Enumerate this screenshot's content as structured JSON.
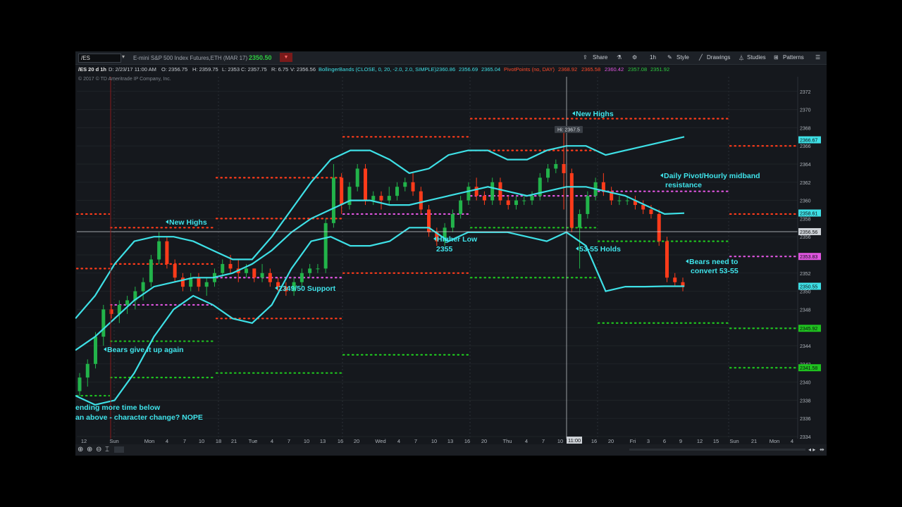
{
  "toolbar": {
    "symbol": "/ES",
    "description": "E-mini S&P 500 Index Futures,ETH (MAR 17)",
    "last_price": "2350.50",
    "share_label": "Share",
    "timeframe": "1h",
    "style_label": "Style",
    "drawings_label": "Drawings",
    "studies_label": "Studies",
    "patterns_label": "Patterns"
  },
  "header": {
    "period": "/ES 20 d 1h",
    "date": "D: 2/23/17 11:00 AM",
    "open": "O: 2356.75",
    "high": "H: 2359.75",
    "low": "L: 2353",
    "close": "C: 2357.75",
    "range": "R: 6.75",
    "value": "V: 2356.56",
    "bb_label": "BollingerBands (CLOSE, 0, 20, -2.0, 2.0, SIMPLE)",
    "bb_values": [
      "2360.86",
      "2356.69",
      "2365.04"
    ],
    "pp_label": "PivotPoints (no, DAY)",
    "pp_values": [
      "2368.92",
      "2365.58",
      "2360.42",
      "2357.08",
      "2351.92"
    ]
  },
  "copyright": "© 2017 © TD Ameritrade IP Company, Inc.",
  "colors": {
    "background": "#15181d",
    "band": "#3ee0e6",
    "up": "#22b34a",
    "down": "#ff3b1a",
    "resistance": "#ff3b1a",
    "support": "#1fc21f",
    "pivot": "#e055e0",
    "annotation": "#3fe3ea"
  },
  "chart_data": {
    "type": "candlestick",
    "title": "/ES 20 d 1h",
    "ylim": [
      2333,
      2373
    ],
    "y_ticks": [
      2334,
      2336,
      2338,
      2340,
      2342,
      2344,
      2346,
      2348,
      2350,
      2352,
      2354,
      2356,
      2358,
      2360,
      2362,
      2364,
      2366,
      2368,
      2370,
      2372
    ],
    "x_ticks": [
      "12",
      "Sun",
      "Mon",
      "4",
      "7",
      "10",
      "18",
      "21",
      "Tue",
      "4",
      "7",
      "10",
      "13",
      "16",
      "20",
      "Wed",
      "4",
      "7",
      "10",
      "13",
      "16",
      "20",
      "Thu",
      "4",
      "7",
      "10",
      "11:00",
      "16",
      "20",
      "Fri",
      "3",
      "6",
      "9",
      "12",
      "15",
      "Sun",
      "21",
      "Mon",
      "4"
    ],
    "price_labels": [
      {
        "value": 2366.67,
        "text": "2366.67",
        "color": "#3ee0e6"
      },
      {
        "value": 2358.61,
        "text": "2358.61",
        "color": "#3ee0e6"
      },
      {
        "value": 2356.56,
        "text": "2356.56",
        "color": "#cfd3d8"
      },
      {
        "value": 2353.83,
        "text": "2353.83",
        "color": "#e055e0"
      },
      {
        "value": 2350.55,
        "text": "2350.55",
        "color": "#3ee0e6"
      },
      {
        "value": 2345.92,
        "text": "2345.92",
        "color": "#1fc21f"
      },
      {
        "value": 2341.58,
        "text": "2341.58",
        "color": "#1fc21f"
      }
    ],
    "crosshair": {
      "x_label": "11:00",
      "price": 2356.56
    },
    "hi_marker": {
      "text": "Hi: 2367.5",
      "value": 2367.5
    },
    "candles": [
      [
        2339.0,
        2341.0,
        2338.5,
        2340.5
      ],
      [
        2340.5,
        2342.5,
        2339.5,
        2342.0
      ],
      [
        2342.0,
        2345.5,
        2341.5,
        2345.0
      ],
      [
        2345.0,
        2348.5,
        2344.0,
        2348.0
      ],
      [
        2348.0,
        2348.5,
        2347.0,
        2347.5
      ],
      [
        2347.5,
        2349.0,
        2346.5,
        2348.5
      ],
      [
        2348.5,
        2349.5,
        2347.5,
        2349.0
      ],
      [
        2349.0,
        2350.5,
        2348.0,
        2350.0
      ],
      [
        2350.0,
        2351.5,
        2349.0,
        2351.0
      ],
      [
        2351.0,
        2354.0,
        2350.5,
        2353.5
      ],
      [
        2353.5,
        2356.5,
        2353.0,
        2355.5
      ],
      [
        2355.5,
        2356.0,
        2352.5,
        2353.0
      ],
      [
        2353.0,
        2353.5,
        2351.0,
        2351.5
      ],
      [
        2351.5,
        2352.0,
        2350.0,
        2350.5
      ],
      [
        2350.5,
        2352.0,
        2350.0,
        2351.5
      ],
      [
        2351.5,
        2352.0,
        2350.0,
        2350.5
      ],
      [
        2350.5,
        2351.5,
        2349.5,
        2351.0
      ],
      [
        2351.0,
        2352.5,
        2350.5,
        2352.0
      ],
      [
        2352.0,
        2353.5,
        2351.5,
        2353.0
      ],
      [
        2353.0,
        2354.0,
        2352.0,
        2352.5
      ],
      [
        2352.5,
        2353.5,
        2351.0,
        2352.0
      ],
      [
        2352.0,
        2353.0,
        2351.5,
        2352.5
      ],
      [
        2352.5,
        2352.5,
        2351.0,
        2351.5
      ],
      [
        2351.5,
        2353.0,
        2351.0,
        2352.0
      ],
      [
        2352.0,
        2352.5,
        2350.5,
        2351.0
      ],
      [
        2351.0,
        2351.5,
        2350.0,
        2350.5
      ],
      [
        2350.5,
        2351.0,
        2349.5,
        2350.0
      ],
      [
        2350.0,
        2351.5,
        2349.5,
        2351.0
      ],
      [
        2351.0,
        2352.5,
        2350.5,
        2352.0
      ],
      [
        2352.0,
        2353.0,
        2351.5,
        2352.5
      ],
      [
        2352.5,
        2353.0,
        2352.0,
        2352.5
      ],
      [
        2352.5,
        2358.0,
        2352.0,
        2357.5
      ],
      [
        2357.5,
        2364.0,
        2357.0,
        2362.5
      ],
      [
        2362.5,
        2363.0,
        2358.5,
        2359.5
      ],
      [
        2359.5,
        2362.0,
        2359.0,
        2361.5
      ],
      [
        2361.5,
        2364.0,
        2361.0,
        2363.5
      ],
      [
        2363.5,
        2364.0,
        2359.5,
        2360.0
      ],
      [
        2360.0,
        2361.0,
        2359.5,
        2360.5
      ],
      [
        2360.5,
        2361.0,
        2359.0,
        2360.0
      ],
      [
        2360.0,
        2361.5,
        2359.5,
        2360.5
      ],
      [
        2360.5,
        2362.0,
        2360.0,
        2361.5
      ],
      [
        2361.5,
        2362.5,
        2361.0,
        2362.0
      ],
      [
        2362.0,
        2363.0,
        2360.5,
        2361.0
      ],
      [
        2361.0,
        2361.5,
        2358.5,
        2359.0
      ],
      [
        2359.0,
        2359.5,
        2356.0,
        2356.5
      ],
      [
        2356.5,
        2357.0,
        2355.0,
        2355.5
      ],
      [
        2355.5,
        2357.5,
        2355.0,
        2357.0
      ],
      [
        2357.0,
        2359.0,
        2356.5,
        2358.5
      ],
      [
        2358.5,
        2360.5,
        2358.0,
        2360.0
      ],
      [
        2360.0,
        2362.0,
        2359.5,
        2361.5
      ],
      [
        2361.5,
        2362.5,
        2360.0,
        2360.5
      ],
      [
        2360.5,
        2361.0,
        2359.5,
        2360.0
      ],
      [
        2360.0,
        2362.5,
        2359.5,
        2362.0
      ],
      [
        2362.0,
        2362.5,
        2359.5,
        2360.0
      ],
      [
        2360.0,
        2360.5,
        2359.0,
        2359.5
      ],
      [
        2359.5,
        2360.5,
        2359.0,
        2360.0
      ],
      [
        2360.0,
        2360.5,
        2359.5,
        2360.0
      ],
      [
        2360.0,
        2361.0,
        2359.5,
        2360.5
      ],
      [
        2360.5,
        2363.0,
        2360.0,
        2362.5
      ],
      [
        2362.5,
        2364.0,
        2362.0,
        2363.5
      ],
      [
        2363.5,
        2364.5,
        2363.0,
        2364.0
      ],
      [
        2364.0,
        2367.5,
        2359.0,
        2363.0
      ],
      [
        2363.0,
        2363.5,
        2356.5,
        2357.0
      ],
      [
        2357.0,
        2359.0,
        2352.5,
        2358.5
      ],
      [
        2358.5,
        2361.0,
        2358.0,
        2360.5
      ],
      [
        2360.5,
        2362.5,
        2360.0,
        2362.0
      ],
      [
        2362.0,
        2363.0,
        2360.5,
        2361.0
      ],
      [
        2361.0,
        2361.5,
        2359.5,
        2360.0
      ],
      [
        2360.0,
        2360.5,
        2359.5,
        2360.0
      ],
      [
        2360.0,
        2360.5,
        2359.5,
        2360.0
      ],
      [
        2360.0,
        2360.5,
        2359.0,
        2359.5
      ],
      [
        2359.5,
        2360.0,
        2358.5,
        2359.0
      ],
      [
        2359.0,
        2359.5,
        2358.0,
        2358.5
      ],
      [
        2358.5,
        2359.0,
        2355.0,
        2355.5
      ],
      [
        2355.5,
        2356.0,
        2351.0,
        2351.5
      ],
      [
        2351.5,
        2352.0,
        2350.5,
        2351.0
      ],
      [
        2351.0,
        2351.5,
        2350.0,
        2350.5
      ]
    ],
    "bollinger": {
      "upper": [
        2347.0,
        2349.5,
        2353.0,
        2355.5,
        2356.0,
        2356.0,
        2355.5,
        2354.5,
        2353.5,
        2353.5,
        2356.0,
        2359.0,
        2362.0,
        2364.5,
        2365.5,
        2365.5,
        2364.5,
        2363.0,
        2363.5,
        2365.0,
        2365.5,
        2365.5,
        2364.5,
        2364.5,
        2365.5,
        2366.0,
        2366.0,
        2365.0,
        2365.5,
        2366.0,
        2366.5,
        2367.0
      ],
      "middle": [
        2343.5,
        2345.0,
        2347.0,
        2349.0,
        2350.5,
        2351.0,
        2351.5,
        2351.5,
        2352.0,
        2353.0,
        2354.5,
        2356.5,
        2358.0,
        2359.0,
        2360.0,
        2360.0,
        2359.5,
        2359.5,
        2360.0,
        2360.5,
        2361.0,
        2361.5,
        2361.0,
        2360.5,
        2361.0,
        2361.5,
        2361.5,
        2361.0,
        2360.5,
        2359.5,
        2358.5,
        2358.6
      ],
      "lower": [
        2338.5,
        2337.5,
        2338.0,
        2341.0,
        2345.0,
        2348.0,
        2349.5,
        2348.5,
        2347.0,
        2346.5,
        2348.5,
        2352.5,
        2355.5,
        2356.0,
        2355.0,
        2355.0,
        2355.5,
        2357.0,
        2357.0,
        2355.5,
        2356.5,
        2356.5,
        2356.5,
        2356.0,
        2355.5,
        2356.5,
        2355.0,
        2350.0,
        2350.5,
        2350.5,
        2350.55,
        2350.55
      ]
    },
    "pivot_levels": [
      {
        "segment": 0,
        "levels": [
          2358.5,
          2352.5,
          2338.5
        ]
      },
      {
        "segment": 1,
        "levels": [
          2357.0,
          2353.0,
          2348.5,
          2344.5,
          2340.5
        ]
      },
      {
        "segment": 2,
        "levels": [
          2362.5,
          2358.0,
          2351.5,
          2347.0,
          2341.0
        ]
      },
      {
        "segment": 3,
        "levels": [
          2367.0,
          2358.5,
          2352.0,
          2343.0
        ]
      },
      {
        "segment": 4,
        "levels": [
          2369.0,
          2365.5,
          2360.5,
          2357.0,
          2351.5
        ]
      },
      {
        "segment": 5,
        "levels": [
          2369.0,
          2361.0,
          2355.5,
          2346.5
        ]
      },
      {
        "segment": 6,
        "levels": [
          2366.0,
          2358.5,
          2353.83,
          2345.92,
          2341.58
        ]
      }
    ],
    "annotations": [
      {
        "text": "New Highs",
        "x": "Mon",
        "y": 2356.0
      },
      {
        "text": "Bears give it up again",
        "x": "Sun",
        "y": 2342.5
      },
      {
        "text": "2349/50 Support",
        "x": "Tue 7",
        "y": 2348.5
      },
      {
        "text": "Higher Low",
        "x": "Wed 7",
        "y": 2353.5
      },
      {
        "text": "2355",
        "x": "Wed 7",
        "y": 2352.5
      },
      {
        "text": "New Highs",
        "x": "Thu 10",
        "y": 2368.5
      },
      {
        "text": "53-55 Holds",
        "x": "Thu 10",
        "y": 2352.5
      },
      {
        "text": "Daily Pivot/Hourly midband",
        "x": "Fri 3",
        "y": 2361.5
      },
      {
        "text": "resistance",
        "x": "Fri 3",
        "y": 2360.5
      },
      {
        "text": "Bears need to",
        "x": "Fri 6",
        "y": 2351.5
      },
      {
        "text": "convert 53-55",
        "x": "Fri 6",
        "y": 2350.5
      },
      {
        "text": "ending more time below",
        "x": "12",
        "y": 2336.0
      },
      {
        "text": "an above - character change? NOPE",
        "x": "12",
        "y": 2335.0
      }
    ]
  }
}
